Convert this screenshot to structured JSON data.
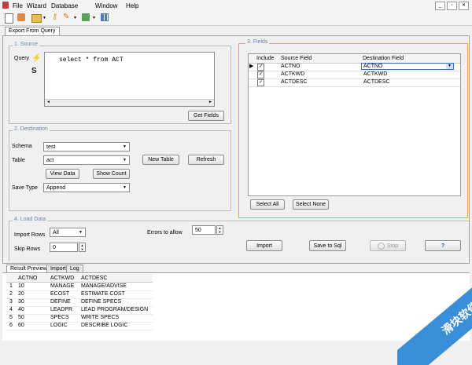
{
  "menu": {
    "items": [
      "File",
      "Wizard",
      "Database",
      "Window",
      "Help"
    ]
  },
  "tabs": {
    "main": "Export From Query"
  },
  "source": {
    "title": "1. Source",
    "query_label": "Query",
    "query_text": "select * from ACT",
    "get_fields": "Get Fields"
  },
  "destination": {
    "title": "2. Destination",
    "schema_label": "Schema",
    "schema_value": "test",
    "table_label": "Table",
    "table_value": "act",
    "new_table": "New Table",
    "refresh": "Refresh",
    "view_data": "View Data",
    "show_count": "Show Count",
    "save_type_label": "Save Type",
    "save_type_value": "Append"
  },
  "fields": {
    "title": "3. Fields",
    "headers": {
      "include": "Include",
      "source": "Source Field",
      "dest": "Destination Field"
    },
    "rows": [
      {
        "source": "ACTNO",
        "dest": "ACTNO"
      },
      {
        "source": "ACTKWD",
        "dest": "ACTKWD"
      },
      {
        "source": "ACTDESC",
        "dest": "ACTDESC"
      }
    ],
    "select_all": "Select All",
    "select_none": "Select None"
  },
  "load": {
    "title": "4. Load Data",
    "import_rows_label": "Import Rows",
    "import_rows_value": "All",
    "skip_rows_label": "Skip Rows",
    "skip_rows_value": "0",
    "errors_label": "Errors to allow",
    "errors_value": "50",
    "import": "Import",
    "save_to_sql": "Save to Sql",
    "stop": "Stop",
    "help": "?"
  },
  "results": {
    "tabs": [
      "Result Preview",
      "Import",
      "Log"
    ],
    "columns": [
      "ACTNO",
      "ACTKWD",
      "ACTDESC"
    ],
    "rows": [
      [
        "1",
        "10",
        "MANAGE",
        "MANAGE/ADVISE"
      ],
      [
        "2",
        "20",
        "ECOST",
        "ESTIMATE COST"
      ],
      [
        "3",
        "30",
        "DEFINE",
        "DEFINE SPECS"
      ],
      [
        "4",
        "40",
        "LEADPR",
        "LEAD PROGRAM/DESIGN"
      ],
      [
        "5",
        "50",
        "SPECS",
        "WRITE SPECS"
      ],
      [
        "6",
        "60",
        "LOGIC",
        "DESCRIBE LOGIC"
      ]
    ]
  },
  "watermark": {
    "text": "滑块软件"
  },
  "colors": {
    "highlight_border": "#e8a44a",
    "group_title": "#6c84a8",
    "row_select": "#c9dff5"
  }
}
